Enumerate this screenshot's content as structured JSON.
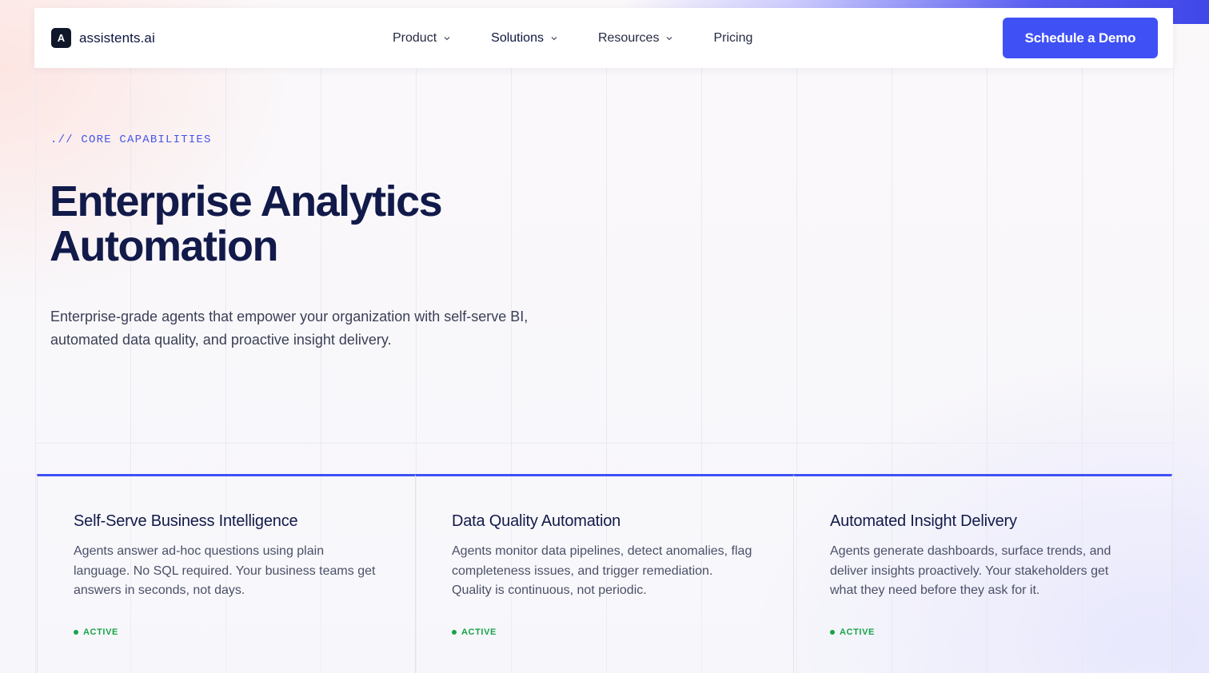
{
  "brand": {
    "mark": "A",
    "name": "assistents.ai"
  },
  "nav": {
    "items": [
      {
        "label": "Product",
        "has_dropdown": true
      },
      {
        "label": "Solutions",
        "has_dropdown": true
      },
      {
        "label": "Resources",
        "has_dropdown": true
      },
      {
        "label": "Pricing",
        "has_dropdown": false
      }
    ],
    "cta_label": "Schedule a Demo"
  },
  "hero": {
    "eyebrow": ".// CORE CAPABILITIES",
    "title_line1": "Enterprise Analytics",
    "title_line2": "Automation",
    "subtitle": "Enterprise-grade agents that empower your organization with self-serve BI, automated data quality, and proactive insight delivery."
  },
  "cards": [
    {
      "title": "Self-Serve Business Intelligence",
      "description": "Agents answer ad-hoc questions using plain language. No SQL required. Your business teams get answers in seconds, not days.",
      "status": "ACTIVE"
    },
    {
      "title": "Data Quality Automation",
      "description": "Agents monitor data pipelines, detect anomalies, flag completeness issues, and trigger remediation. Quality is continuous, not periodic.",
      "status": "ACTIVE"
    },
    {
      "title": "Automated Insight Delivery",
      "description": "Agents generate dashboards, surface trends, and deliver insights proactively. Your stakeholders get what they need before they ask for it.",
      "status": "ACTIVE"
    }
  ],
  "colors": {
    "accent": "#3f51f5",
    "status_active": "#19a34a",
    "heading": "#121a4a"
  }
}
